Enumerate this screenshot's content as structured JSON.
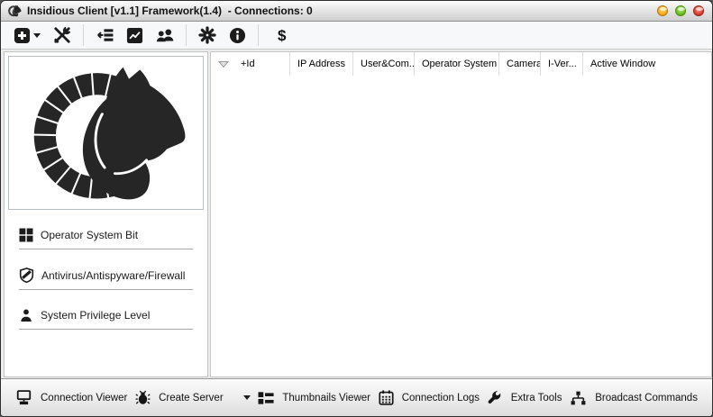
{
  "window": {
    "title": "Insidious Client [v1.1] Framework(1.4)  - Connections: 0",
    "connections_count": 0,
    "controls": [
      {
        "name": "minimize",
        "color": "#f0a30a"
      },
      {
        "name": "maximize",
        "color": "#5fb40e"
      },
      {
        "name": "close",
        "color": "#d32f20"
      }
    ]
  },
  "top_toolbar": {
    "dollar_label": "$",
    "icons": [
      "add-server-icon",
      "tools-icon",
      "assign-list-icon",
      "chart-icon",
      "users-icon",
      "burst-icon",
      "info-icon",
      "dollar-button"
    ]
  },
  "main_table": {
    "columns": [
      {
        "label": "+Id"
      },
      {
        "label": "IP Address"
      },
      {
        "label": "User&Com..."
      },
      {
        "label": "Operator System"
      },
      {
        "label": "Camera"
      },
      {
        "label": "I-Ver..."
      },
      {
        "label": "Active Window"
      }
    ],
    "rows": []
  },
  "sidebar": {
    "items": [
      {
        "label": "Operator System Bit",
        "icon": "os-squares-icon"
      },
      {
        "label": "Antivirus/Antispyware/Firewall",
        "icon": "shield-icon"
      },
      {
        "label": "System Privilege Level",
        "icon": "person-icon"
      }
    ]
  },
  "bottom_toolbar": {
    "items": [
      {
        "label": "Connection Viewer",
        "icon": "monitor-network-icon"
      },
      {
        "label": "Create Server",
        "icon": "bug-icon",
        "has_dropdown": true
      },
      {
        "label": "Thumbnails Viewer",
        "icon": "thumbnail-list-icon"
      },
      {
        "label": "Connection Logs",
        "icon": "calendar-icon"
      },
      {
        "label": "Extra Tools",
        "icon": "wrench-icon"
      },
      {
        "label": "Broadcast Commands",
        "icon": "pipe-network-icon"
      }
    ]
  },
  "colors": {
    "icon": "#1c1c1c",
    "titlebar_gradient_top": "#fdfdfd",
    "titlebar_gradient_bottom": "#cfcfcf",
    "toolbar_bg": "#f7f8f9",
    "panel_border": "#c3c3c3"
  }
}
